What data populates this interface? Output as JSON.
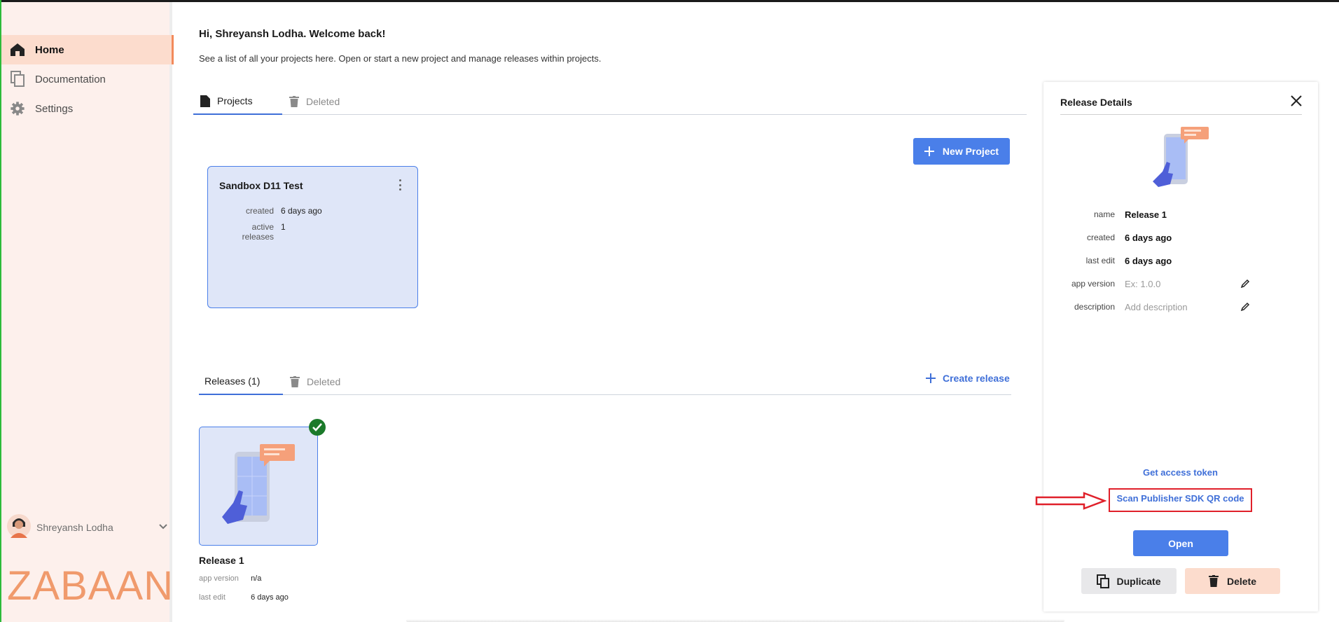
{
  "sidebar": {
    "items": [
      {
        "label": "Home",
        "icon": "home-icon",
        "active": true
      },
      {
        "label": "Documentation",
        "icon": "copy-icon",
        "active": false
      },
      {
        "label": "Settings",
        "icon": "gear-icon",
        "active": false
      }
    ],
    "user_name": "Shreyansh Lodha",
    "logo_text": "ZABAAN"
  },
  "main": {
    "greeting": "Hi, Shreyansh Lodha. Welcome back!",
    "subtitle": "See a list of all your projects here. Open or start a new project and manage releases within projects.",
    "project_tabs": [
      {
        "label": "Projects",
        "icon": "file-icon"
      },
      {
        "label": "Deleted",
        "icon": "trash-icon"
      }
    ],
    "new_project_label": "New Project",
    "project": {
      "name": "Sandbox D11 Test",
      "created_label": "created",
      "created_value": "6 days ago",
      "active_label": "active releases",
      "active_value": "1"
    },
    "release_tabs": [
      {
        "label": "Releases (1)"
      },
      {
        "label": "Deleted",
        "icon": "trash-icon"
      }
    ],
    "create_release_label": "Create release",
    "release": {
      "name": "Release 1",
      "app_version_label": "app version",
      "app_version_value": "n/a",
      "last_edit_label": "last edit",
      "last_edit_value": "6 days ago"
    }
  },
  "panel": {
    "title": "Release Details",
    "fields": [
      {
        "label": "name",
        "value": "Release 1"
      },
      {
        "label": "created",
        "value": "6 days ago"
      },
      {
        "label": "last edit",
        "value": "6 days ago"
      },
      {
        "label": "app version",
        "value": "Ex: 1.0.0"
      },
      {
        "label": "description",
        "value": "Add description"
      }
    ],
    "get_token_label": "Get access token",
    "scan_qr_label": "Scan Publisher SDK QR code",
    "open_label": "Open",
    "duplicate_label": "Duplicate",
    "delete_label": "Delete"
  },
  "colors": {
    "accent": "#4a7fe9",
    "sidebar_bg": "#fdf0ec",
    "active_bg": "#fcdccd",
    "brand_orange": "#f09a6c",
    "annotation_red": "#e0202a"
  }
}
